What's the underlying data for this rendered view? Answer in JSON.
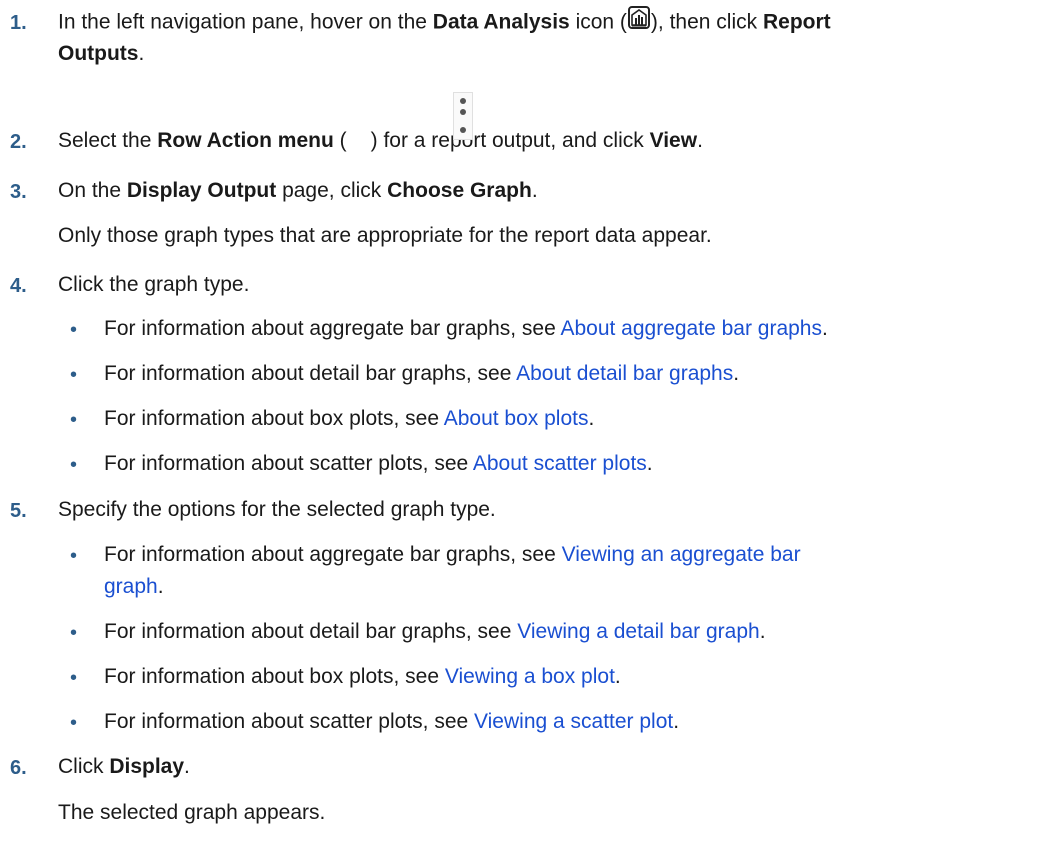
{
  "steps": [
    {
      "num": "1.",
      "t1": "In the left navigation pane, hover on the ",
      "b1": "Data Analysis",
      "t2": " icon (",
      "icon": "data-analysis-icon",
      "t3": "), then click ",
      "b2": "Report",
      "b3": "Outputs",
      "t4": "."
    },
    {
      "num": "2.",
      "t1": "Select the ",
      "b1": "Row Action menu",
      "t2": " (",
      "icon": "row-action-kebab-icon",
      "t3": ") for a report output, and click ",
      "b2": "View",
      "t4": "."
    },
    {
      "num": "3.",
      "t1": "On the ",
      "b1": "Display Output",
      "t2": " page, click ",
      "b2": "Choose Graph",
      "t3": ".",
      "note": "Only those graph types that are appropriate for the report data appear."
    },
    {
      "num": "4.",
      "t1": "Click the graph type.",
      "bullets": [
        {
          "prefix": "For information about aggregate bar graphs, see ",
          "link": "About aggregate bar graphs",
          "suffix": "."
        },
        {
          "prefix": "For information about detail bar graphs, see ",
          "link": "About detail bar graphs",
          "suffix": "."
        },
        {
          "prefix": "For information about box plots, see ",
          "link": "About box plots",
          "suffix": "."
        },
        {
          "prefix": "For information about scatter plots, see ",
          "link": "About scatter plots",
          "suffix": "."
        }
      ]
    },
    {
      "num": "5.",
      "t1": "Specify the options for the selected graph type.",
      "bullets": [
        {
          "prefix": "For information about aggregate bar graphs, see ",
          "link": "Viewing an aggregate bar",
          "link2": "graph",
          "suffix": "."
        },
        {
          "prefix": "For information about detail bar graphs, see ",
          "link": "Viewing a detail bar graph",
          "suffix": "."
        },
        {
          "prefix": "For information about box plots, see ",
          "link": "Viewing a box plot",
          "suffix": "."
        },
        {
          "prefix": "For information about scatter plots, see ",
          "link": "Viewing a scatter plot",
          "suffix": "."
        }
      ]
    },
    {
      "num": "6.",
      "t1": "Click ",
      "b1": "Display",
      "t2": ".",
      "note": "The selected graph appears."
    }
  ],
  "colors": {
    "accent": "#2d5d8a",
    "link": "#1a4fd1",
    "text": "#1a1a1a"
  }
}
